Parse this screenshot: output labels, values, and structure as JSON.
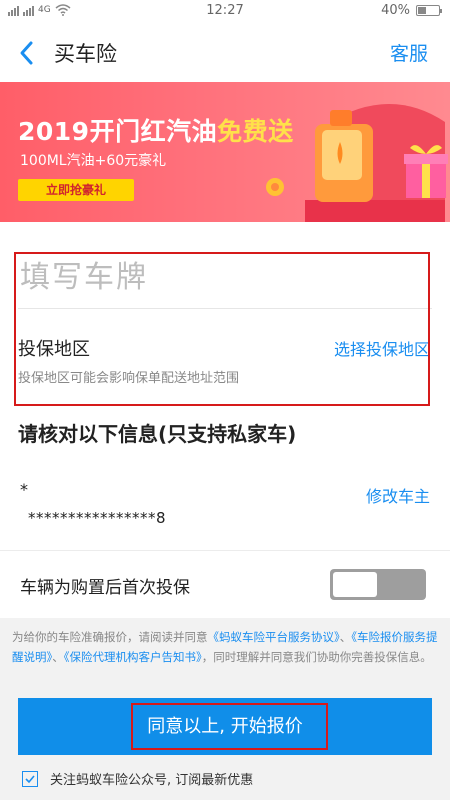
{
  "status": {
    "carrier": "4G",
    "time": "12:27",
    "battery_text": "40%",
    "battery_level": 0.4
  },
  "nav": {
    "title": "买车险",
    "service": "客服"
  },
  "banner": {
    "title_prefix": "2019开门红汽油",
    "title_highlight": "免费送",
    "subtitle": "100ML汽油+60元豪礼",
    "cta": "立即抢豪礼"
  },
  "form": {
    "plate_placeholder": "填写车牌",
    "region_label": "投保地区",
    "region_select": "选择投保地区",
    "region_hint": "投保地区可能会影响保单配送地址范围"
  },
  "verify": {
    "title": "请核对以下信息(只支持私家车)",
    "owner_name": "*",
    "owner_id": "****************8",
    "edit_owner": "修改车主",
    "first_insure_label": "车辆为购置后首次投保",
    "first_insure_on": false
  },
  "notice": {
    "part1": "为给你的车险准确报价，请阅读并同意",
    "link1": "《蚂蚁车险平台服务协议》",
    "sep1": "、",
    "link2": "《车险报价服务提醒说明》",
    "sep2": "、",
    "link3": "《保险代理机构客户告知书》",
    "part2": "，同时理解并同意我们协助你完善投保信息。"
  },
  "start_button": "同意以上, 开始报价",
  "follow": {
    "checked": true,
    "label": "关注蚂蚁车险公众号, 订阅最新优惠"
  },
  "colors": {
    "accent": "#1a8ef0",
    "button": "#108ee9",
    "banner": "#ff6f7a",
    "highlight_box": "#d61a1a"
  }
}
